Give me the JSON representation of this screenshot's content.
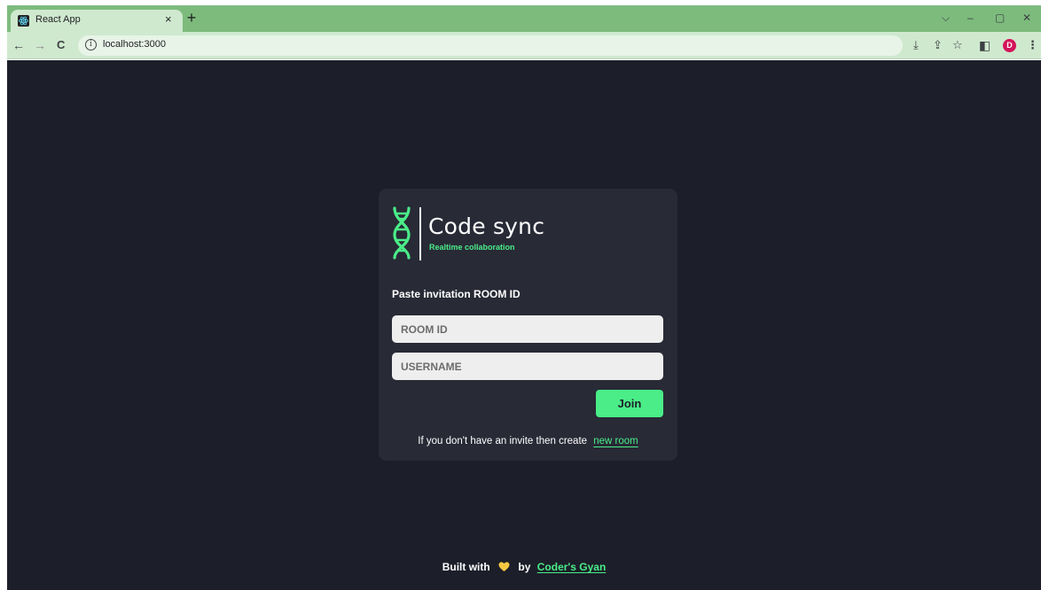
{
  "browser": {
    "tab_title": "React App",
    "tab_close": "×",
    "new_tab": "+",
    "url": "localhost:3000",
    "controls": {
      "dropdown": "⌵",
      "minimize": "–",
      "restore": "▢",
      "close": "✕"
    },
    "nav": {
      "back": "←",
      "forward": "→",
      "reload": "C"
    },
    "toolbar_icons": {
      "install": "⤓",
      "share": "⇪",
      "bookmark": "☆",
      "sidepanel": "◧"
    },
    "avatar_initial": "D",
    "menu": "⋮"
  },
  "app": {
    "logo_title": "Code sync",
    "logo_subtitle": "Realtime collaboration",
    "heading": "Paste invitation ROOM ID",
    "room_placeholder": "ROOM ID",
    "username_placeholder": "USERNAME",
    "join_label": "Join",
    "invite_text": "If you don't have an invite then create",
    "invite_link": "new room",
    "footer_prefix": "Built with",
    "footer_by": "by",
    "footer_link": "Coder's Gyan",
    "accent_color": "#4aed88",
    "background_color": "#1c1e29",
    "card_color": "#282a36"
  }
}
